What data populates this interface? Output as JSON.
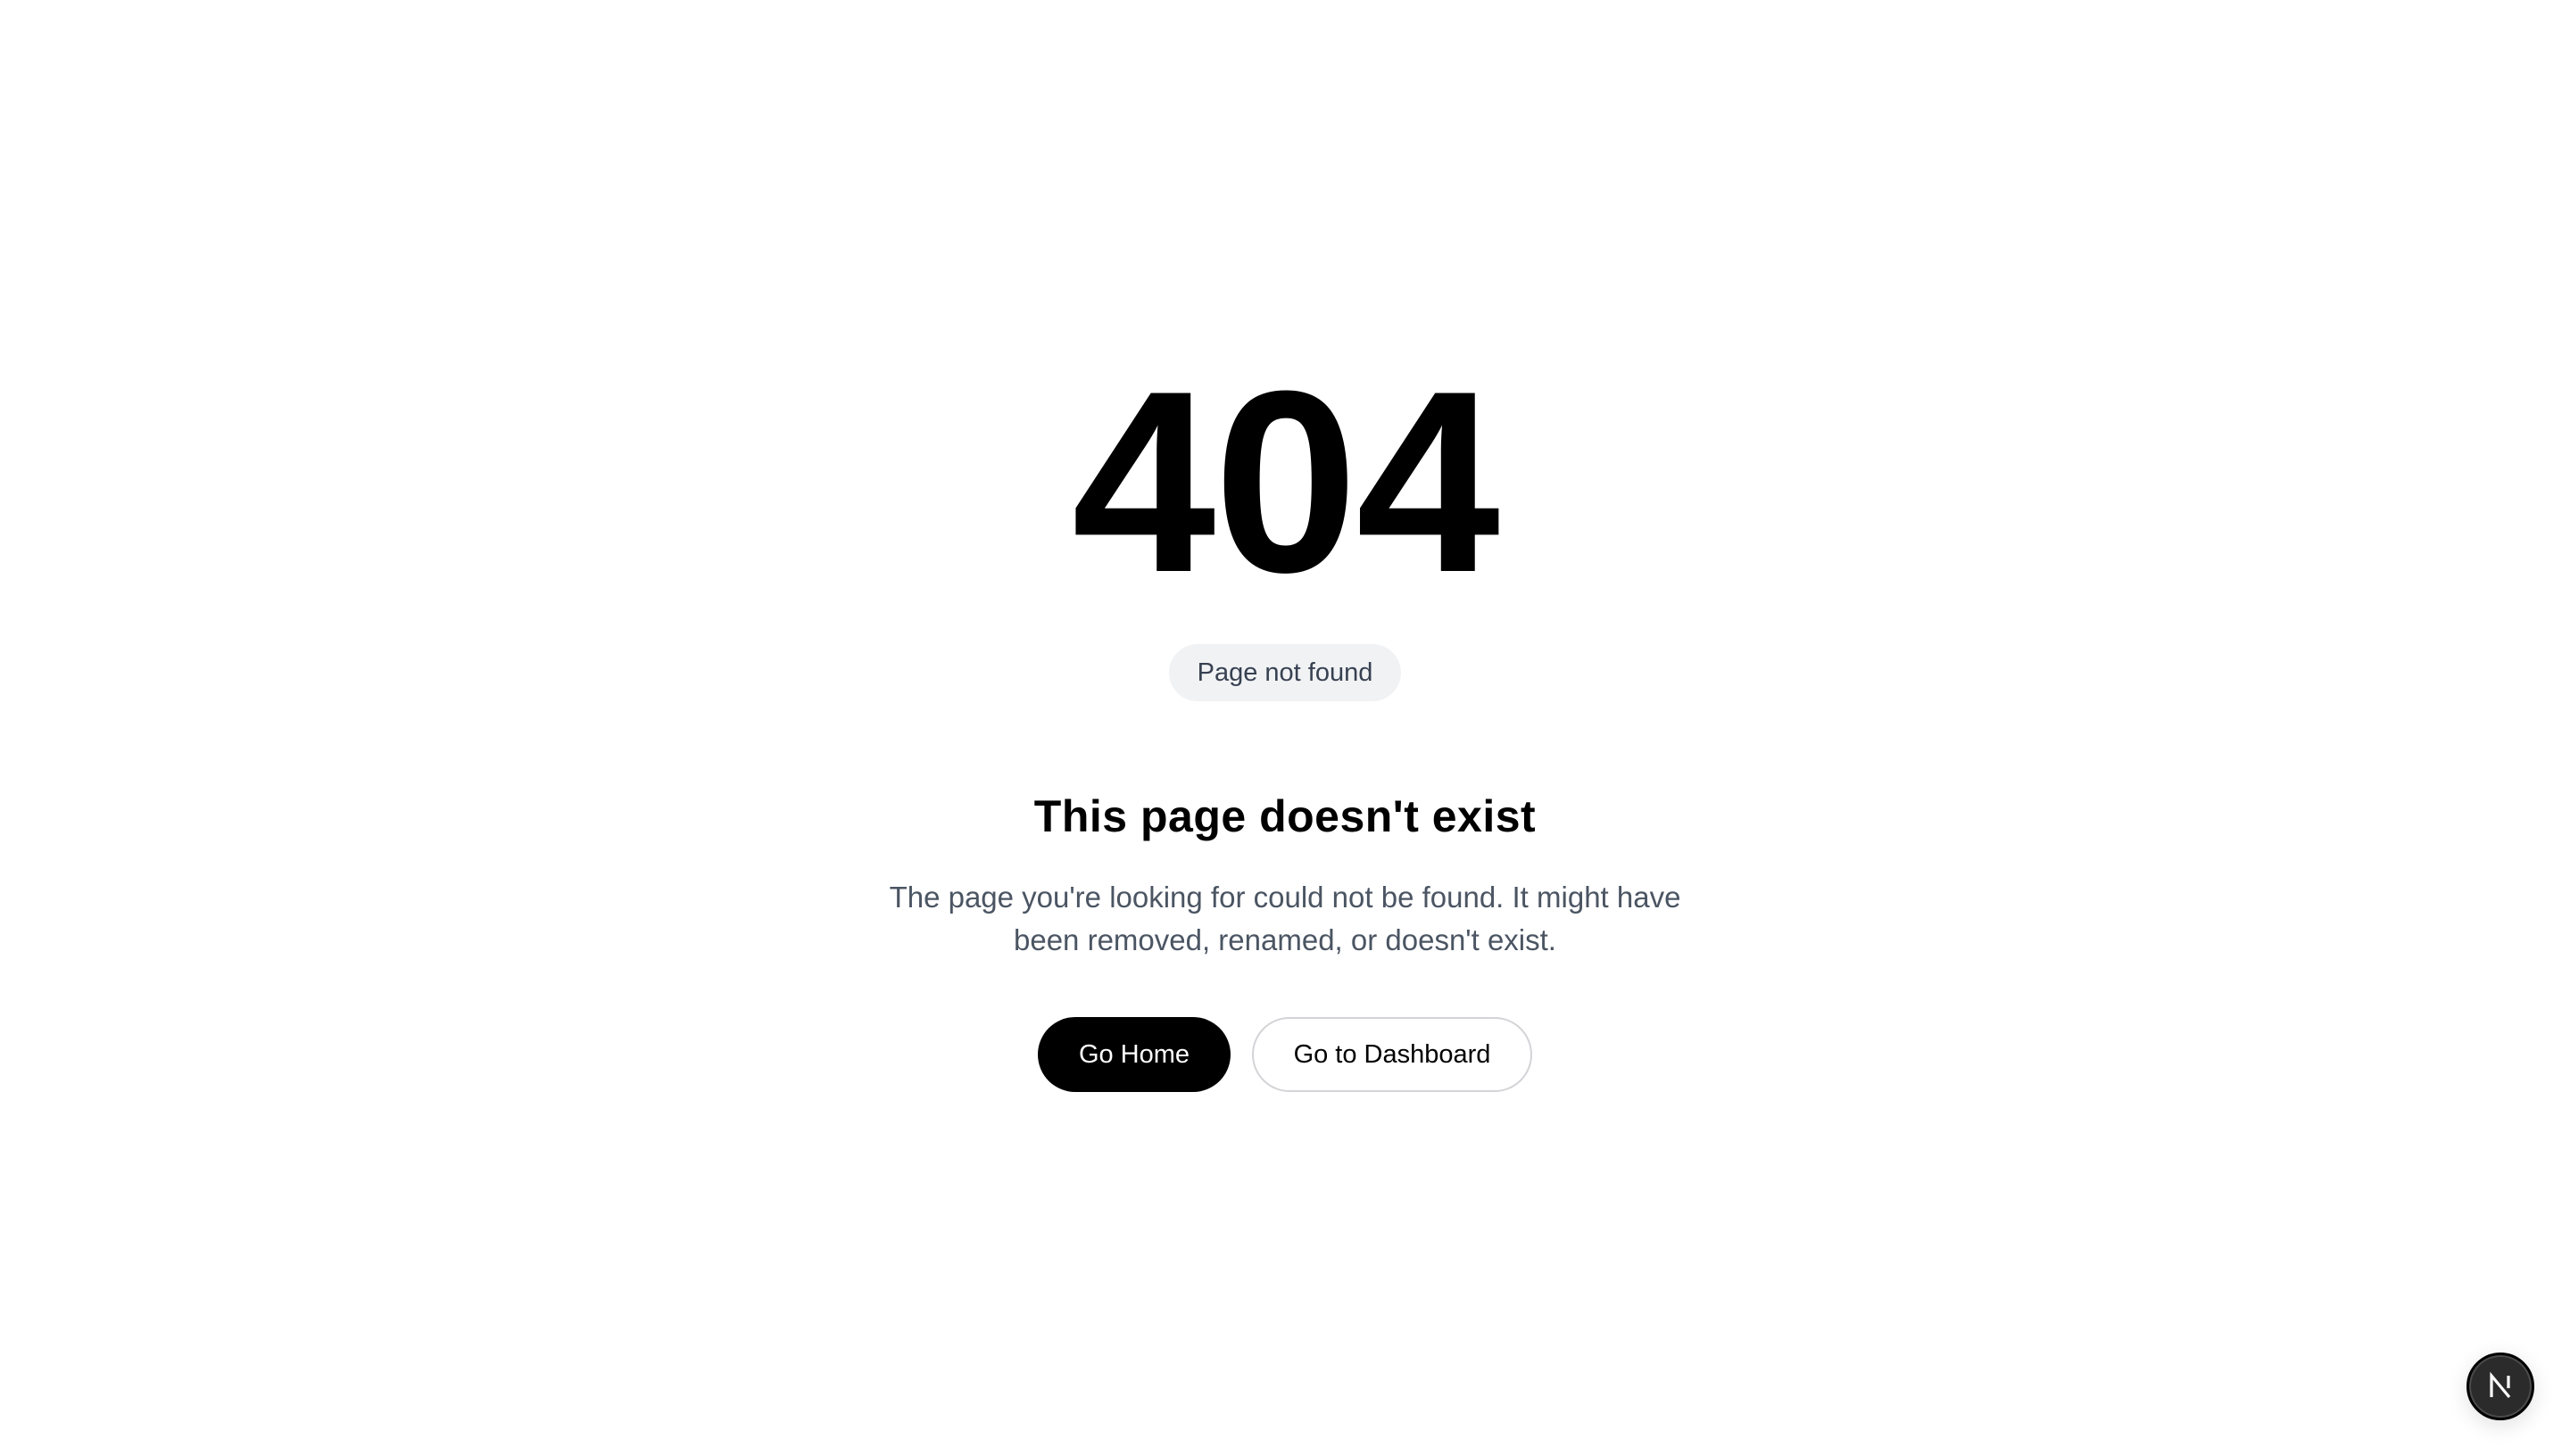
{
  "error": {
    "code": "404",
    "badge": "Page not found",
    "title": "This page doesn't exist",
    "description": "The page you're looking for could not be found. It might have been removed, renamed, or doesn't exist."
  },
  "actions": {
    "home_label": "Go Home",
    "dashboard_label": "Go to Dashboard"
  },
  "dev_indicator": {
    "icon": "nextjs-logo-icon",
    "background": "#2b2b2b"
  },
  "colors": {
    "primary_button_bg": "#000000",
    "primary_button_text": "#ffffff",
    "badge_bg": "#f1f2f4",
    "description_text": "#4b5563"
  }
}
